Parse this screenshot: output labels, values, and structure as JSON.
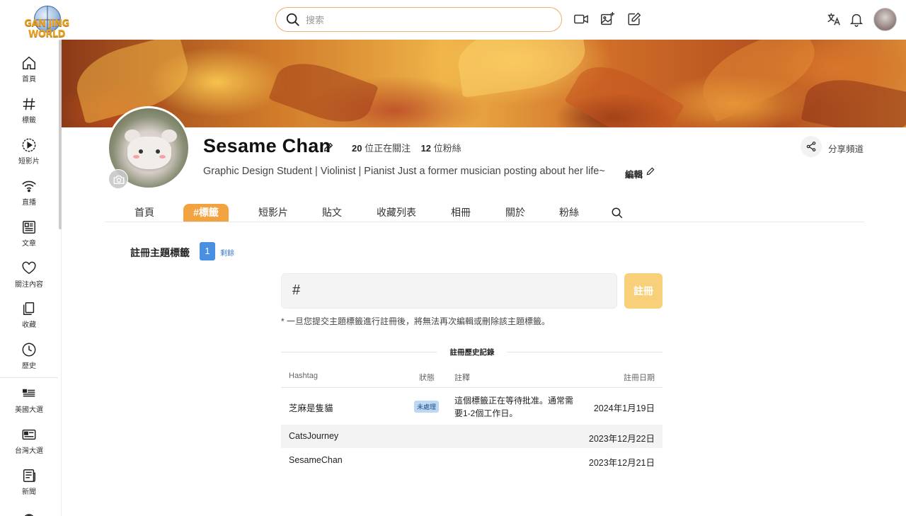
{
  "app": {
    "logo_text": "GAN JING WORLD"
  },
  "topbar": {
    "search_placeholder": "搜索",
    "icons": [
      "search-icon",
      "video-camera-icon",
      "add-image-icon",
      "compose-icon",
      "translate-icon",
      "bell-icon"
    ]
  },
  "sidebar": {
    "items": [
      {
        "label": "首頁",
        "icon": "home-icon"
      },
      {
        "label": "標籤",
        "icon": "hashtag-icon"
      },
      {
        "label": "短影片",
        "icon": "play-icon"
      },
      {
        "label": "直播",
        "icon": "wifi-icon"
      },
      {
        "label": "文章",
        "icon": "article-icon"
      },
      {
        "label": "關注內容",
        "icon": "heart-icon"
      },
      {
        "label": "收藏",
        "icon": "bookmark-icon"
      },
      {
        "label": "歷史",
        "icon": "clock-icon"
      },
      {
        "label": "美國大選",
        "icon": "us-election-icon"
      },
      {
        "label": "台灣大選",
        "icon": "tw-election-icon"
      },
      {
        "label": "新聞",
        "icon": "news-icon"
      }
    ]
  },
  "profile": {
    "name": "Sesame Chan",
    "following_count": "20",
    "following_label": "位正在關注",
    "fans_count": "12",
    "fans_label": "位粉絲",
    "share_label": "分享頻道",
    "bio": "Graphic Design Student | Violinist | Pianist Just a former musician posting about her life~",
    "edit_label": "編輯"
  },
  "tabs": [
    {
      "label": "首頁",
      "active": false
    },
    {
      "label": "#標籤",
      "active": true
    },
    {
      "label": "短影片",
      "active": false
    },
    {
      "label": "貼文",
      "active": false
    },
    {
      "label": "收藏列表",
      "active": false
    },
    {
      "label": "相冊",
      "active": false
    },
    {
      "label": "關於",
      "active": false
    },
    {
      "label": "粉絲",
      "active": false
    }
  ],
  "hashtag_register": {
    "title": "註冊主題標籤",
    "remaining_count": "1",
    "remaining_label": "剩餘",
    "input_prefix": "#",
    "input_value": "",
    "register_button": "註冊",
    "note": "* 一旦您提交主題標籤進行註冊後，將無法再次編輯或刪除該主題標籤。",
    "history_title": "註冊歷史記錄"
  },
  "history_table": {
    "columns": [
      "Hashtag",
      "狀態",
      "註釋",
      "註冊日期"
    ],
    "rows": [
      {
        "hashtag": "芝麻是隻貓",
        "status": "未處理",
        "note": "這個標籤正在等待批准。通常需要1-2個工作日。",
        "date": "2024年1月19日"
      },
      {
        "hashtag": "CatsJourney",
        "status": "",
        "note": "",
        "date": "2023年12月22日"
      },
      {
        "hashtag": "SesameChan",
        "status": "",
        "note": "",
        "date": "2023年12月21日"
      }
    ]
  },
  "colors": {
    "accent": "#f2a33f",
    "search_border": "#e8b068",
    "register_button": "#f9d07a",
    "count_badge": "#4a90e2"
  }
}
